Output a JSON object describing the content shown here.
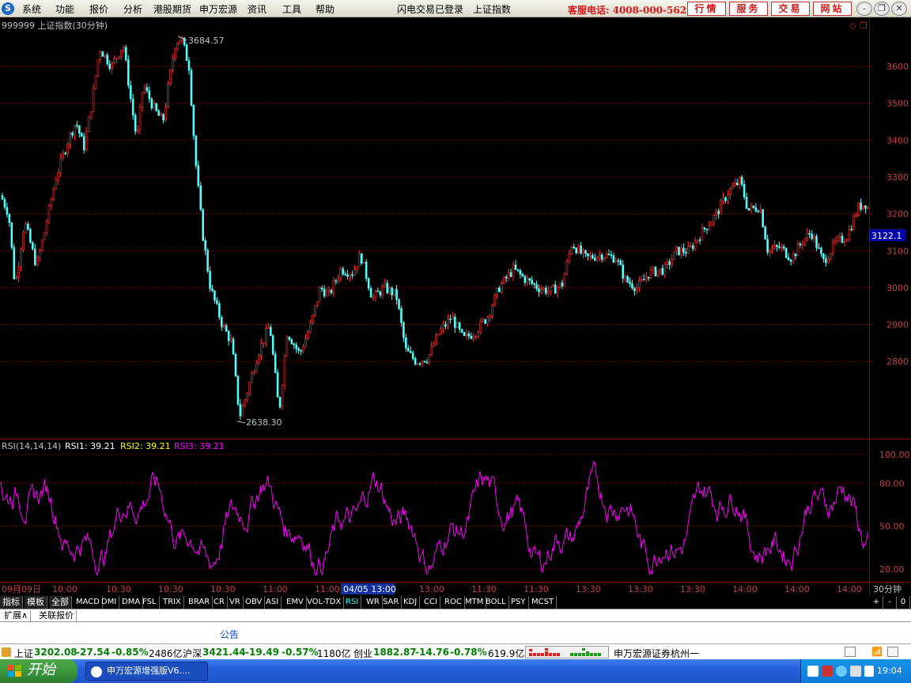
{
  "menubar": {
    "logo": "S",
    "items": [
      "系统",
      "功能",
      "报价",
      "分析",
      "港股期货",
      "申万宏源",
      "资讯",
      "工具",
      "帮助"
    ],
    "login_status": "闪电交易已登录",
    "current_index": "上证指数",
    "hotline": "客服电话: 4008-000-562",
    "buttons": [
      "行情",
      "服务",
      "交易",
      "网站"
    ]
  },
  "main_chart": {
    "title": "999999 上证指数(30分钟)",
    "high_label": "3684.57",
    "low_label": "2638.30",
    "current_price": "3122.1",
    "y_ticks": [
      "3600",
      "3500",
      "3400",
      "3300",
      "3200",
      "3100",
      "3000",
      "2900",
      "2800"
    ],
    "colors": {
      "up": "#ff3232",
      "down": "#54fcfc",
      "grid": "#8c0000",
      "text": "#c0c0c0"
    }
  },
  "rsi_panel": {
    "label": "RSI(14,14,14)",
    "rsi1": "RSI1: 39.21",
    "rsi2": "RSI2: 39.21",
    "rsi3": "RSI3: 39.21",
    "y_ticks": [
      "100.00",
      "80.00",
      "50.00",
      "20.00"
    ],
    "colors": {
      "rsi1": "#ffffff",
      "rsi2": "#ffff00",
      "rsi3": "#ff00ff"
    }
  },
  "time_axis": {
    "labels": [
      "09月09日",
      "10:00",
      "10:30",
      "10:30",
      "10:30",
      "11:00",
      "11:00",
      "13:00",
      "11:30",
      "11:30",
      "13:30",
      "13:30",
      "13:30",
      "14:00",
      "14:00",
      "14:00"
    ],
    "cursor_label": "04/05 13:00",
    "period": "30分钟"
  },
  "indicator_tabs": {
    "left": [
      "指标",
      "模板",
      "全部"
    ],
    "items": [
      "MACD",
      "DMI",
      "DMA",
      "FSL",
      "TRIX",
      "BRAR",
      "CR",
      "VR",
      "OBV",
      "ASI",
      "EMV",
      "VOL-TDX",
      "RSI",
      "WR",
      "SAR",
      "KDJ",
      "CCI",
      "ROC",
      "MTM",
      "BOLL",
      "PSY",
      "MCST"
    ],
    "active": "RSI",
    "right": [
      "+",
      "-",
      "0"
    ]
  },
  "sub_tabs": [
    "扩展∧",
    "关联报价"
  ],
  "notice": {
    "label": "公告"
  },
  "quotes": {
    "sh": {
      "name": "上证",
      "price": "3202.08",
      "change": "-27.54",
      "pct": "-0.85%",
      "vol": "2486亿"
    },
    "hs": {
      "name": "沪深",
      "price": "3421.44",
      "change": "-19.49",
      "pct": "-0.57%",
      "vol": "1180亿"
    },
    "cy": {
      "name": "创业",
      "price": "1882.87",
      "change": "-14.76",
      "pct": "-0.78%",
      "vol": "619.9亿"
    },
    "broker": "申万宏源证券杭州一"
  },
  "taskbar": {
    "start": "开始",
    "task": "申万宏源增强版V6....",
    "time": "19:04"
  }
}
